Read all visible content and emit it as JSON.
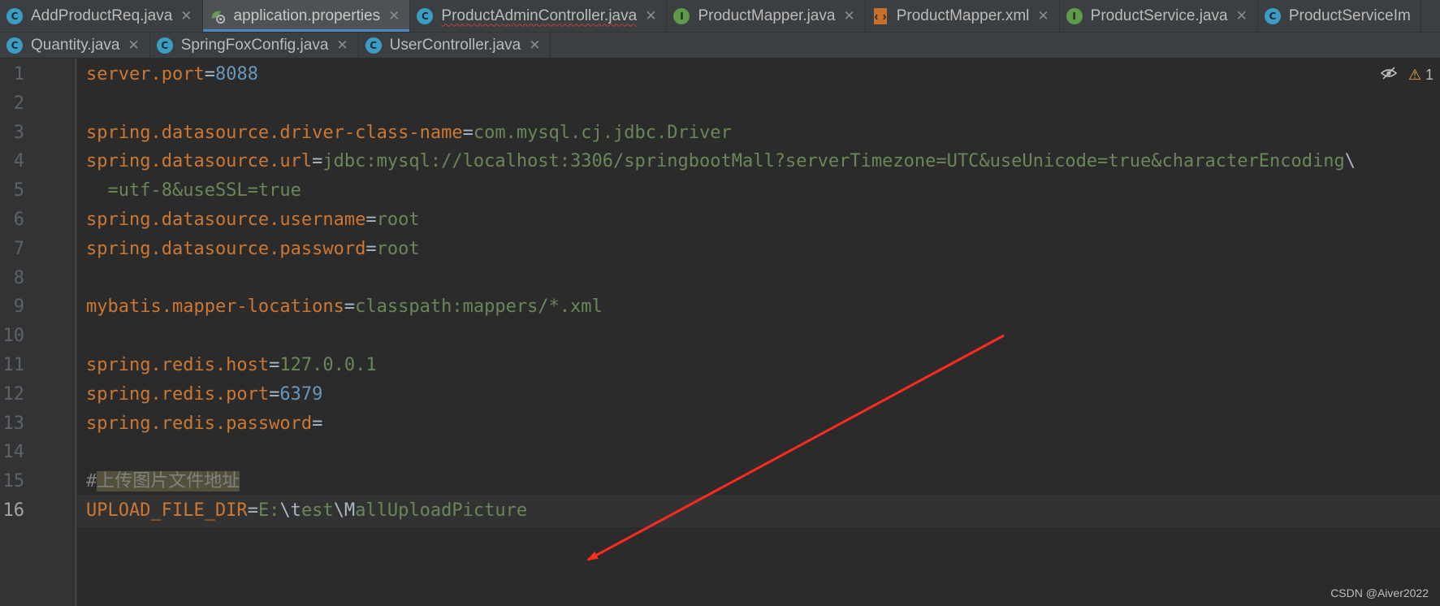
{
  "tabs_row1": [
    {
      "label": "AddProductReq.java",
      "icon": "class-icon",
      "type": "cls"
    },
    {
      "label": "application.properties",
      "icon": "properties-file-icon",
      "type": "props",
      "active": true
    },
    {
      "label": "ProductAdminController.java",
      "icon": "class-icon",
      "type": "cls",
      "error": true
    },
    {
      "label": "ProductMapper.java",
      "icon": "interface-icon",
      "type": "iface"
    },
    {
      "label": "ProductMapper.xml",
      "icon": "xml-file-icon",
      "type": "xml"
    },
    {
      "label": "ProductService.java",
      "icon": "interface-icon",
      "type": "iface"
    },
    {
      "label": "ProductServiceIm",
      "icon": "class-icon",
      "type": "cls",
      "truncated": true
    }
  ],
  "tabs_row2": [
    {
      "label": "Quantity.java",
      "icon": "class-icon",
      "type": "cls"
    },
    {
      "label": "SpringFoxConfig.java",
      "icon": "class-icon",
      "type": "cls"
    },
    {
      "label": "UserController.java",
      "icon": "class-icon",
      "type": "cls"
    }
  ],
  "icon_glyphs": {
    "cls": "C",
    "iface": "I"
  },
  "close_glyph": "✕",
  "inspection": {
    "warning_count": "1",
    "warning_glyph": "⚠",
    "reader_mode_glyph": "👁"
  },
  "current_line": 16,
  "lines": [
    {
      "num": "1",
      "key": "server.port",
      "value": "8088",
      "vtype": "n"
    },
    {
      "num": "2"
    },
    {
      "num": "3",
      "key": "spring.datasource.driver-class-name",
      "value": "com.mysql.cj.jdbc.Driver",
      "vtype": "v"
    },
    {
      "num": "4",
      "key": "spring.datasource.url",
      "value": "jdbc:mysql://localhost:3306/springbootMall?serverTimezone=UTC&useUnicode=true&characterEncoding",
      "vtype": "v",
      "trail": "\\"
    },
    {
      "num": "5",
      "cont": "  =utf-8&useSSL=true"
    },
    {
      "num": "6",
      "key": "spring.datasource.username",
      "value": "root",
      "vtype": "v"
    },
    {
      "num": "7",
      "key": "spring.datasource.password",
      "value": "root",
      "vtype": "v"
    },
    {
      "num": "8"
    },
    {
      "num": "9",
      "key": "mybatis.mapper-locations",
      "value": "classpath:mappers/*.xml",
      "vtype": "v"
    },
    {
      "num": "10"
    },
    {
      "num": "11",
      "key": "spring.redis.host",
      "value": "127.0.0.1",
      "vtype": "v"
    },
    {
      "num": "12",
      "key": "spring.redis.port",
      "value": "6379",
      "vtype": "n"
    },
    {
      "num": "13",
      "key": "spring.redis.password",
      "value": "",
      "vtype": "v"
    },
    {
      "num": "14"
    },
    {
      "num": "15",
      "comment_hash": "#",
      "comment_text": "上传图片文件地址"
    },
    {
      "num": "16",
      "key": "UPLOAD_FILE_DIR",
      "value_parts": [
        {
          "t": "E:",
          "c": "v"
        },
        {
          "t": "\\t",
          "c": "esc"
        },
        {
          "t": "est",
          "c": "v"
        },
        {
          "t": "\\M",
          "c": "esc"
        },
        {
          "t": "allUploadPicture",
          "c": "v"
        }
      ]
    }
  ],
  "watermark": "CSDN @Aiver2022",
  "colors": {
    "key": "#cc7832",
    "value": "#6a8759",
    "number": "#6897bb",
    "comment": "#808080",
    "arrow": "#ff2a1f"
  }
}
